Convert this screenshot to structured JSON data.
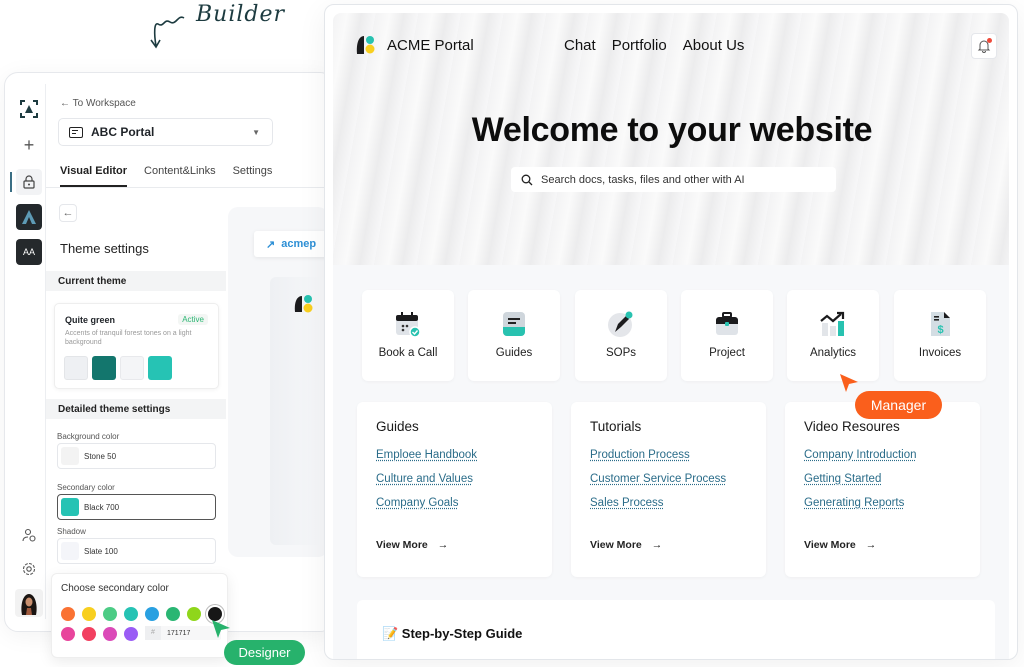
{
  "caption": "Builder",
  "builder": {
    "back_link": "← To Workspace",
    "portal_name": "ABC Portal",
    "tabs": [
      "Visual Editor",
      "Content&Links",
      "Settings"
    ],
    "rail_badge": "AA",
    "theme_settings_title": "Theme settings",
    "current_theme_heading": "Current theme",
    "theme": {
      "name": "Quite green",
      "status": "Active",
      "description": "Accents of tranquil forest tones on a light background",
      "swatches": [
        "#eef0f3",
        "#13766d",
        "#f4f5f7",
        "#26c3b4"
      ]
    },
    "detailed_heading": "Detailed theme settings",
    "fields": [
      {
        "label": "Background color",
        "value": "Stone 50",
        "color": "#f3f3f3"
      },
      {
        "label": "Secondary color",
        "value": "Black 700",
        "color": "#26c3b4"
      },
      {
        "label": "Shadow",
        "value": "Slate 100",
        "color": "#f4f5f9"
      }
    ],
    "picker": {
      "title": "Choose secondary color",
      "colors_row1": [
        "#fa7233",
        "#f8cf1f",
        "#4ccc85",
        "#26c3b4",
        "#29a0e1",
        "#2ab673",
        "#8fd61b",
        "#171717"
      ],
      "colors_row2": [
        "#e8459c",
        "#f24060",
        "#db4ab8",
        "#9a5cf5"
      ],
      "hex_prefix": "#",
      "hex_value": "171717"
    },
    "designer_label": "Designer",
    "preview_url": "acmep"
  },
  "portal": {
    "brand": "ACME Portal",
    "nav": [
      "Chat",
      "Portfolio",
      "About Us"
    ],
    "hero_title": "Welcome to your website",
    "search_placeholder": "Search docs, tasks, files and other with AI",
    "tiles": [
      "Book a Call",
      "Guides",
      "SOPs",
      "Project",
      "Analytics",
      "Invoices"
    ],
    "cards": [
      {
        "title": "Guides",
        "links": [
          "Emploee Handbook",
          "Culture and Values",
          "Company Goals"
        ],
        "more": "View More"
      },
      {
        "title": "Tutorials",
        "links": [
          "Production Process",
          "Customer Service Process",
          "Sales Process"
        ],
        "more": "View More"
      },
      {
        "title": "Video Resoures",
        "links": [
          "Company Introduction",
          "Getting Started",
          "Generating Reports"
        ],
        "more": "View More"
      }
    ],
    "guide_title": "📝 Step-by-Step Guide",
    "manager_label": "Manager"
  }
}
